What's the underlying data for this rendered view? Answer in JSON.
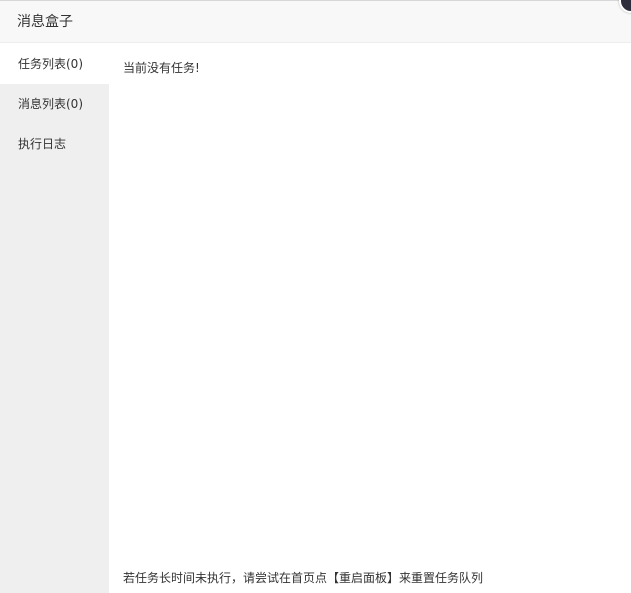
{
  "window": {
    "title": "消息盒子"
  },
  "sidebar": {
    "items": [
      {
        "label": "任务列表(0)",
        "active": true
      },
      {
        "label": "消息列表(0)",
        "active": false
      },
      {
        "label": "执行日志",
        "active": false
      }
    ]
  },
  "main": {
    "empty_text": "当前没有任务!",
    "footer_hint": "若任务长时间未执行，请尝试在首页点【重启面板】来重置任务队列"
  },
  "colors": {
    "sidebar_bg": "#efefef",
    "header_bg": "#f8f8f8",
    "close_button": "#2e2d3c"
  }
}
